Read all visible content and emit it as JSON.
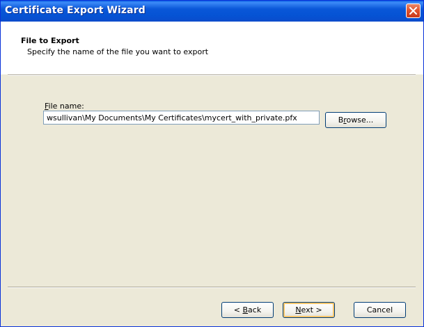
{
  "window": {
    "title": "Certificate Export Wizard"
  },
  "header": {
    "title": "File to Export",
    "subtitle": "Specify the name of the file you want to export"
  },
  "form": {
    "file_name_label_accel": "F",
    "file_name_label_rest": "ile name:",
    "file_name_value": "wsullivan\\My Documents\\My Certificates\\mycert_with_private.pfx",
    "browse_accel": "r",
    "browse_pre": "B",
    "browse_post": "owse..."
  },
  "footer": {
    "back_pre": "< ",
    "back_accel": "B",
    "back_post": "ack",
    "next_accel": "N",
    "next_post": "ext >",
    "cancel_label": "Cancel"
  },
  "colors": {
    "title_bar": "#0553d4",
    "dialog_face": "#ece9d8",
    "close_button": "#e1542e"
  },
  "icons": {
    "close": "close-icon"
  }
}
